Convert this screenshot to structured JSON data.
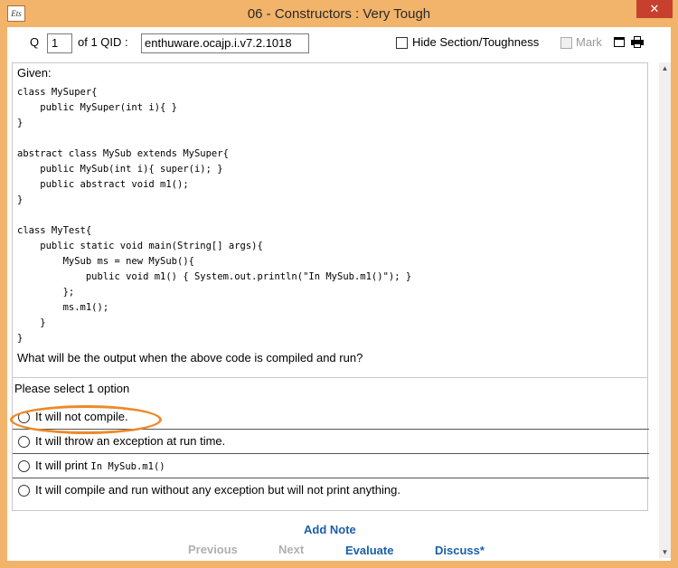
{
  "window": {
    "app_icon_text": "Ets",
    "title": "06 - Constructors  :  Very Tough",
    "close_label": "✕"
  },
  "toolbar": {
    "q_label": "Q",
    "q_value": "1",
    "of_label": "of 1  QID :",
    "qid_value": "enthuware.ocajp.i.v7.2.1018",
    "hide_label": "Hide Section/Toughness",
    "hide_checked": false,
    "mark_label": "Mark",
    "mark_enabled": false
  },
  "question": {
    "given_label": "Given:",
    "code": "class MySuper{\n    public MySuper(int i){ }\n}\n\nabstract class MySub extends MySuper{\n    public MySub(int i){ super(i); }\n    public abstract void m1();\n}\n\nclass MyTest{\n    public static void main(String[] args){\n        MySub ms = new MySub(){\n            public void m1() { System.out.println(\"In MySub.m1()\"); }\n        };\n        ms.m1();\n    }\n}",
    "prompt": "What will be the output when the above code is compiled and run?"
  },
  "options": {
    "select_label": "Please select 1 option",
    "items": [
      {
        "label": "It will not compile.",
        "code": ""
      },
      {
        "label": "It will throw an exception at run time.",
        "code": ""
      },
      {
        "label": "It will print ",
        "code": "In MySub.m1()"
      },
      {
        "label": "It will compile and run without any exception but will not print anything.",
        "code": ""
      }
    ]
  },
  "actions": {
    "add_note": "Add Note",
    "previous": "Previous",
    "next": "Next",
    "evaluate": "Evaluate",
    "discuss": "Discuss*"
  },
  "colors": {
    "frame": "#f2b36a",
    "close_button": "#c7402d",
    "link": "#1a5fa8",
    "highlight": "#ec8a2a"
  }
}
